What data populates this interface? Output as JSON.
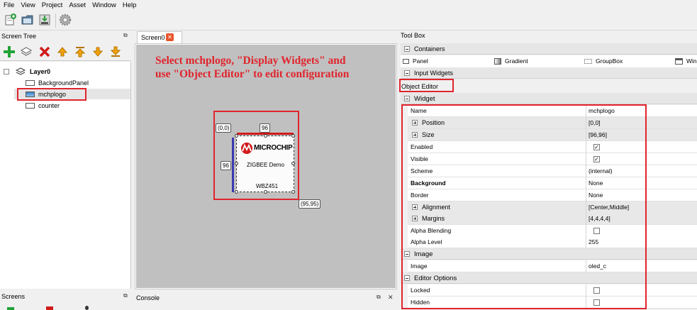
{
  "menu": [
    "File",
    "View",
    "Project",
    "Asset",
    "Window",
    "Help"
  ],
  "screen_tree": {
    "title": "Screen Tree",
    "items": [
      {
        "label": "Layer0"
      },
      {
        "label": "BackgroundPanel"
      },
      {
        "label": "mchplogo"
      },
      {
        "label": "counter"
      }
    ]
  },
  "screens": {
    "title": "Screens"
  },
  "console": {
    "title": "Console"
  },
  "canvas": {
    "tab_label": "Screen0",
    "instruction_line1": "Select mchplogo, \"Display Widgets\" and",
    "instruction_line2": "use \"Object Editor\" to edit configuration",
    "origin_label": "(0,0)",
    "width_label": "96",
    "height_label": "96",
    "end_label": "(95,95)",
    "logo_brand": "MICROCHIP",
    "logo_line1": "ZIGBEE Demo",
    "logo_line2": "WBZ451"
  },
  "toolbox": {
    "title": "Tool Box",
    "containers_label": "Containers",
    "container_items": [
      "Panel",
      "Gradient",
      "GroupBox",
      "Win"
    ],
    "input_widgets_label": "Input Widgets",
    "object_editor_label": "Object Editor"
  },
  "properties": {
    "widget_group": "Widget",
    "image_group": "Image",
    "editor_group": "Editor Options",
    "rows": {
      "name": {
        "label": "Name",
        "value": "mchplogo"
      },
      "position": {
        "label": "Position",
        "value": "[0,0]"
      },
      "size": {
        "label": "Size",
        "value": "[96,96]"
      },
      "enabled": {
        "label": "Enabled",
        "checked": true
      },
      "visible": {
        "label": "Visible",
        "checked": true
      },
      "scheme": {
        "label": "Scheme",
        "value": "(internal)"
      },
      "background": {
        "label": "Background",
        "value": "None"
      },
      "border": {
        "label": "Border",
        "value": "None"
      },
      "alignment": {
        "label": "Alignment",
        "value": "[Center,Middle]"
      },
      "margins": {
        "label": "Margins",
        "value": "[4,4,4,4]"
      },
      "alpha_blending": {
        "label": "Alpha Blending",
        "checked": false
      },
      "alpha_level": {
        "label": "Alpha Level",
        "value": "255"
      },
      "image": {
        "label": "Image",
        "value": "oled_c"
      },
      "locked": {
        "label": "Locked",
        "checked": false
      },
      "hidden": {
        "label": "Hidden",
        "checked": false
      }
    }
  },
  "colors": {
    "annotation_red": "#e0242c",
    "canvas_gray": "#c0c0c0"
  }
}
